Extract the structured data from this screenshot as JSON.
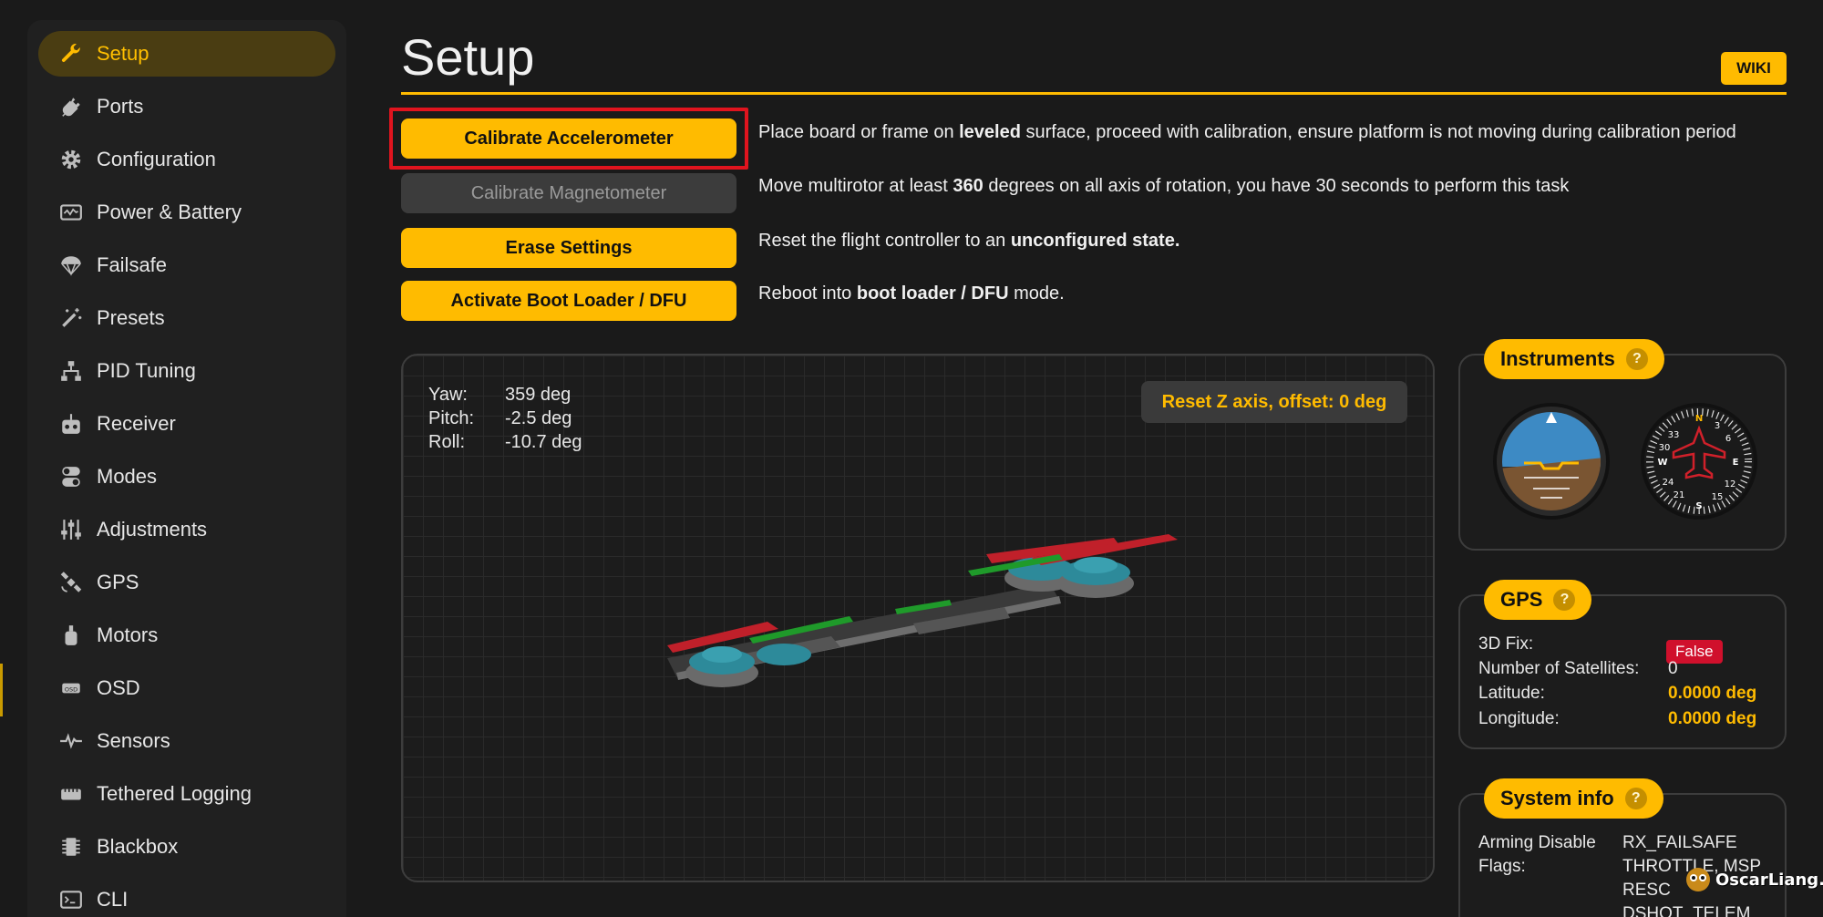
{
  "sidebar": {
    "items": [
      {
        "label": "Setup",
        "icon": "wrench-icon",
        "active": true
      },
      {
        "label": "Ports",
        "icon": "plug-icon"
      },
      {
        "label": "Configuration",
        "icon": "gear-icon"
      },
      {
        "label": "Power & Battery",
        "icon": "battery-graph-icon"
      },
      {
        "label": "Failsafe",
        "icon": "parachute-icon"
      },
      {
        "label": "Presets",
        "icon": "magic-wand-icon"
      },
      {
        "label": "PID Tuning",
        "icon": "hierarchy-icon"
      },
      {
        "label": "Receiver",
        "icon": "remote-control-icon"
      },
      {
        "label": "Modes",
        "icon": "toggle-icon"
      },
      {
        "label": "Adjustments",
        "icon": "sliders-icon"
      },
      {
        "label": "GPS",
        "icon": "satellite-icon"
      },
      {
        "label": "Motors",
        "icon": "motor-icon"
      },
      {
        "label": "OSD",
        "icon": "osd-icon"
      },
      {
        "label": "Sensors",
        "icon": "pulse-icon"
      },
      {
        "label": "Tethered Logging",
        "icon": "logging-icon"
      },
      {
        "label": "Blackbox",
        "icon": "chip-icon"
      },
      {
        "label": "CLI",
        "icon": "terminal-icon"
      }
    ]
  },
  "header": {
    "title": "Setup",
    "wiki_label": "WIKI"
  },
  "actions": [
    {
      "label": "Calibrate Accelerometer",
      "enabled": true,
      "desc_parts": [
        "Place board or frame on ",
        "leveled",
        " surface, proceed with calibration, ensure platform is not moving during calibration period"
      ]
    },
    {
      "label": "Calibrate Magnetometer",
      "enabled": false,
      "desc_parts": [
        "Move multirotor at least ",
        "360",
        " degrees on all axis of rotation, you have 30 seconds to perform this task"
      ]
    },
    {
      "label": "Erase Settings",
      "enabled": true,
      "desc_parts": [
        "Reset the flight controller to an ",
        "unconfigured state.",
        ""
      ]
    },
    {
      "label": "Activate Boot Loader / DFU",
      "enabled": true,
      "desc_parts": [
        "Reboot into ",
        "boot loader / DFU",
        " mode."
      ]
    }
  ],
  "attitude": {
    "yaw_label": "Yaw:",
    "yaw_value": "359 deg",
    "pitch_label": "Pitch:",
    "pitch_value": "-2.5 deg",
    "roll_label": "Roll:",
    "roll_value": "-10.7 deg",
    "reset_label": "Reset Z axis, offset: 0 deg"
  },
  "instruments": {
    "title": "Instruments",
    "help": "?",
    "heading_labels": [
      "N",
      "E",
      "S",
      "W",
      "33",
      "30",
      "3",
      "6",
      "12",
      "15",
      "21",
      "24"
    ]
  },
  "gps": {
    "title": "GPS",
    "help": "?",
    "fix_label": "3D Fix:",
    "fix_value": "False",
    "sats_label": "Number of Satellites:",
    "sats_value": "0",
    "lat_label": "Latitude:",
    "lat_value": "0.0000 deg",
    "lon_label": "Longitude:",
    "lon_value": "0.0000 deg"
  },
  "system_info": {
    "title": "System info",
    "help": "?",
    "arming_label_1": "Arming Disable",
    "arming_label_2": "Flags:",
    "flags": [
      "RX_FAILSAFE",
      "THROTTLE, MSP",
      "RESC",
      "DSHOT_TELEM"
    ]
  },
  "watermark": {
    "text": "OscarLiang.com"
  },
  "colors": {
    "accent": "#ffbb00",
    "highlight": "#e0141e",
    "false_badge": "#d0102c",
    "bg": "#1a1a1a"
  }
}
